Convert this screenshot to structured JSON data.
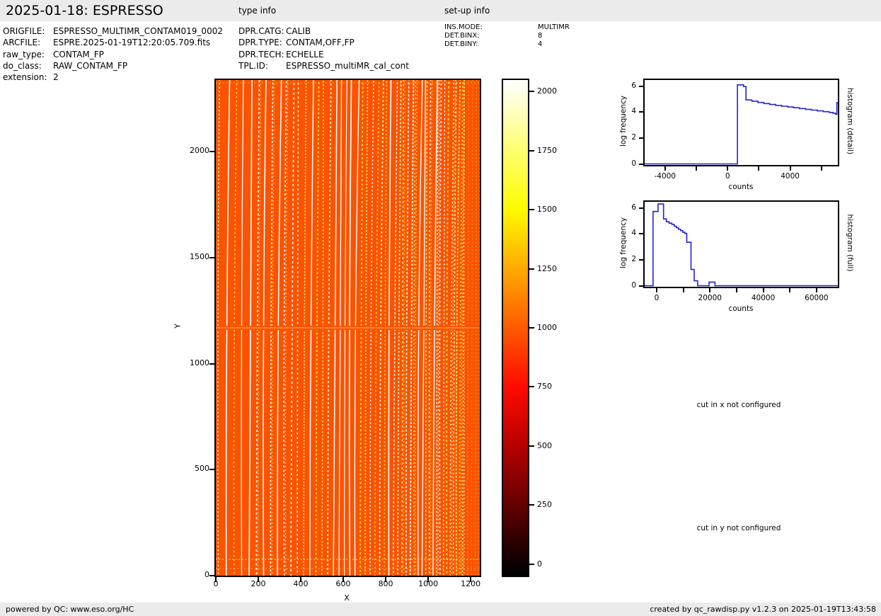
{
  "header": {
    "title": "2025-01-18: ESPRESSO",
    "type_info_heading": "type info",
    "setup_info_heading": "set-up info"
  },
  "file_info": {
    "rows": [
      {
        "label": "ORIGFILE:",
        "value": "ESPRESSO_MULTIMR_CONTAM019_0002"
      },
      {
        "label": "ARCFILE:",
        "value": "ESPRE.2025-01-19T12:20:05.709.fits"
      },
      {
        "label": "raw_type:",
        "value": "CONTAM_FP"
      },
      {
        "label": "do_class:",
        "value": "RAW_CONTAM_FP"
      },
      {
        "label": "extension:",
        "value": "2"
      }
    ]
  },
  "type_info": {
    "rows": [
      {
        "label": "DPR.CATG:",
        "value": "CALIB"
      },
      {
        "label": "DPR.TYPE:",
        "value": "CONTAM,OFF,FP"
      },
      {
        "label": "DPR.TECH:",
        "value": "ECHELLE"
      },
      {
        "label": "TPL.ID:",
        "value": "ESPRESSO_multiMR_cal_cont"
      }
    ]
  },
  "setup_info": {
    "rows": [
      {
        "label": "INS.MODE:",
        "value": "MULTIMR"
      },
      {
        "label": "DET.BINX:",
        "value": "8"
      },
      {
        "label": "DET.BINY:",
        "value": "4"
      }
    ]
  },
  "messages": {
    "cut_x": "cut in x not configured",
    "cut_y": "cut in y not configured"
  },
  "footer": {
    "left": "powered by QC: www.eso.org/HC",
    "right": "created by qc_rawdisp.py v1.2.3 on 2025-01-19T13:43:58"
  },
  "colors": {
    "bar_gray": "#ebebeb",
    "histogram_line": "#2424cf",
    "text": "#000000"
  },
  "chart_data": [
    {
      "id": "raw_image",
      "type": "heatmap",
      "xlabel": "X",
      "ylabel": "Y",
      "xlim": [
        0,
        1243
      ],
      "ylim": [
        0,
        2339
      ],
      "x_ticks": [
        0,
        200,
        400,
        600,
        800,
        1000,
        1200
      ],
      "y_ticks": [
        0,
        500,
        1000,
        1500,
        2000
      ],
      "description": "ESPRESSO raw CONTAM_FP echelle frame: uniform orange background (~1100 counts, hot colormap) crossed by ~48 nearly vertical, slightly curved dotted Fabry-Perot order stripes in yellow/white; stripe spacing narrows from ~11px (left) to ~4px (right); faint stripe zone at far right; bright uniform gap row at Y~1165; brighter dotted rows near Y~75",
      "colors": {
        "background": "#fb5300",
        "stripes": [
          "#ffd400",
          "#ffdf33",
          "#ffec70",
          "#fff9c0",
          "#ffffff"
        ],
        "gap_line": "#ff9a45"
      }
    },
    {
      "id": "colorbar",
      "type": "colorbar",
      "ticks": [
        0,
        250,
        500,
        750,
        1000,
        1250,
        1500,
        1750,
        2000
      ],
      "vmin": -48,
      "vmax": 2048,
      "colormap": "hot",
      "stops": [
        [
          0,
          "#000000"
        ],
        [
          2.3,
          "#0d0000"
        ],
        [
          14.2,
          "#630000"
        ],
        [
          26.1,
          "#b60000"
        ],
        [
          38.1,
          "#ff0b00"
        ],
        [
          50,
          "#ff5a00"
        ],
        [
          61.9,
          "#ffaa00"
        ],
        [
          73.9,
          "#fffa00"
        ],
        [
          85.8,
          "#ffff70"
        ],
        [
          97.7,
          "#ffffe8"
        ],
        [
          100,
          "#ffffff"
        ]
      ]
    },
    {
      "id": "histogram_detail",
      "type": "line",
      "right_label": "histogram (detail)",
      "xlabel": "counts",
      "ylabel": "log frequency",
      "xlim": [
        -5300,
        7050
      ],
      "ylim": [
        -0.08,
        6.47
      ],
      "x_ticks": [
        {
          "v": -4000,
          "label": "-4000"
        },
        {
          "v": -2000,
          "label": ""
        },
        {
          "v": 0,
          "label": "0"
        },
        {
          "v": 2000,
          "label": ""
        },
        {
          "v": 4000,
          "label": "4000"
        },
        {
          "v": 6000,
          "label": ""
        }
      ],
      "y_ticks": [
        0,
        2,
        4,
        6
      ],
      "steps": [
        [
          -5300,
          0
        ],
        [
          630,
          0
        ],
        [
          630,
          6.1
        ],
        [
          1020,
          6.1
        ],
        [
          1020,
          5.97
        ],
        [
          1180,
          5.97
        ],
        [
          1180,
          4.93
        ],
        [
          1560,
          4.93
        ],
        [
          1560,
          4.84
        ],
        [
          1940,
          4.84
        ],
        [
          1940,
          4.74
        ],
        [
          2320,
          4.74
        ],
        [
          2320,
          4.65
        ],
        [
          2700,
          4.65
        ],
        [
          2700,
          4.58
        ],
        [
          3080,
          4.58
        ],
        [
          3080,
          4.51
        ],
        [
          3460,
          4.51
        ],
        [
          3460,
          4.45
        ],
        [
          3840,
          4.45
        ],
        [
          3840,
          4.39
        ],
        [
          4220,
          4.39
        ],
        [
          4220,
          4.33
        ],
        [
          4600,
          4.33
        ],
        [
          4600,
          4.27
        ],
        [
          4980,
          4.27
        ],
        [
          4980,
          4.21
        ],
        [
          5360,
          4.21
        ],
        [
          5360,
          4.15
        ],
        [
          5740,
          4.15
        ],
        [
          5740,
          4.09
        ],
        [
          6120,
          4.09
        ],
        [
          6120,
          4.03
        ],
        [
          6500,
          4.03
        ],
        [
          6500,
          3.97
        ],
        [
          6750,
          3.97
        ],
        [
          6750,
          3.9
        ],
        [
          6900,
          3.9
        ],
        [
          6900,
          3.84
        ],
        [
          6985,
          3.84
        ],
        [
          6985,
          4.73
        ],
        [
          7050,
          4.73
        ]
      ]
    },
    {
      "id": "histogram_full",
      "type": "line",
      "right_label": "histogram (full)",
      "xlabel": "counts",
      "ylabel": "log frequency",
      "xlim": [
        -4500,
        68000
      ],
      "ylim": [
        -0.08,
        6.47
      ],
      "x_ticks": [
        {
          "v": 0,
          "label": "0"
        },
        {
          "v": 10000,
          "label": ""
        },
        {
          "v": 20000,
          "label": "20000"
        },
        {
          "v": 30000,
          "label": ""
        },
        {
          "v": 40000,
          "label": "40000"
        },
        {
          "v": 50000,
          "label": ""
        },
        {
          "v": 60000,
          "label": "60000"
        }
      ],
      "y_ticks": [
        0,
        2,
        4,
        6
      ],
      "steps": [
        [
          -4500,
          0
        ],
        [
          -1350,
          0
        ],
        [
          -1350,
          5.72
        ],
        [
          520,
          5.72
        ],
        [
          520,
          6.3
        ],
        [
          2600,
          6.3
        ],
        [
          2600,
          5.15
        ],
        [
          3650,
          5.15
        ],
        [
          3650,
          4.93
        ],
        [
          4700,
          4.93
        ],
        [
          4700,
          4.82
        ],
        [
          5700,
          4.82
        ],
        [
          5700,
          4.73
        ],
        [
          6600,
          4.73
        ],
        [
          6600,
          4.58
        ],
        [
          7400,
          4.58
        ],
        [
          7400,
          4.47
        ],
        [
          8200,
          4.47
        ],
        [
          8200,
          4.35
        ],
        [
          9000,
          4.35
        ],
        [
          9000,
          4.25
        ],
        [
          9800,
          4.25
        ],
        [
          9800,
          4.12
        ],
        [
          10600,
          4.12
        ],
        [
          10600,
          4.03
        ],
        [
          11300,
          4.03
        ],
        [
          11300,
          3.35
        ],
        [
          12900,
          3.35
        ],
        [
          12900,
          1.25
        ],
        [
          14100,
          1.25
        ],
        [
          14100,
          0.38
        ],
        [
          15400,
          0.38
        ],
        [
          15400,
          0
        ],
        [
          19700,
          0
        ],
        [
          19700,
          0.28
        ],
        [
          21900,
          0.28
        ],
        [
          21900,
          0
        ],
        [
          68000,
          0
        ]
      ]
    }
  ]
}
